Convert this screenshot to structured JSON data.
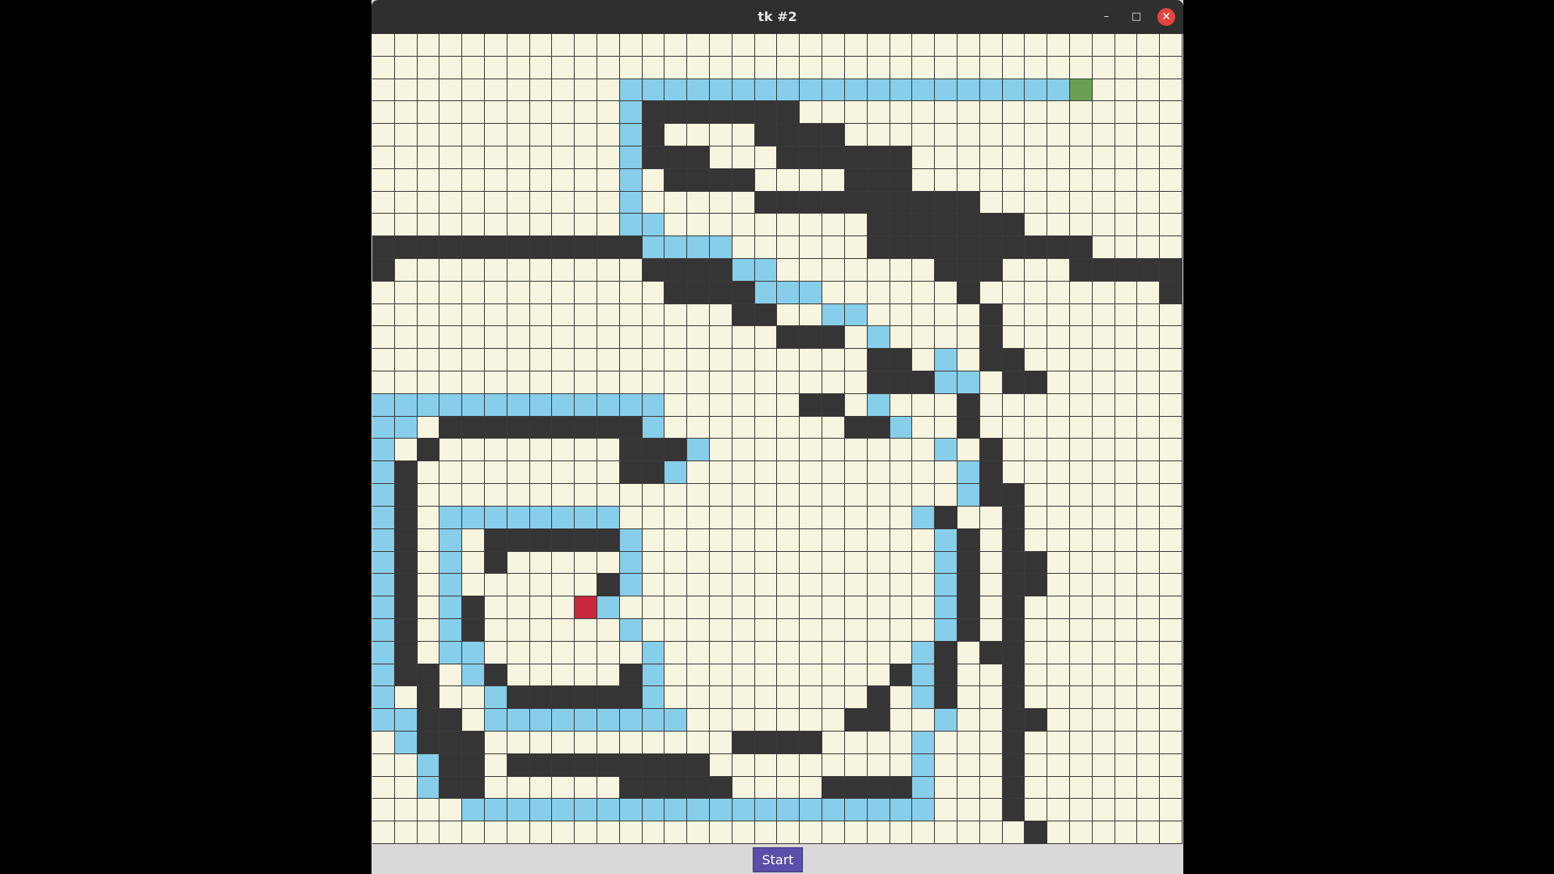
{
  "window": {
    "title": "tk #2",
    "minimize_glyph": "–",
    "maximize_glyph": "□",
    "close_glyph": "✕"
  },
  "controls": {
    "start_label": "Start"
  },
  "maze": {
    "cols": 36,
    "rows": 36,
    "legend": {
      ".": "empty",
      "#": "wall",
      "o": "path",
      "S": "start",
      "E": "end"
    },
    "colors": {
      "empty": "#f7f5df",
      "wall": "#353535",
      "path": "#87ceeb",
      "start": "#6aa054",
      "end": "#c9283c",
      "grid_line": "#3a3a3a"
    },
    "grid": [
      "....................................",
      "....................................",
      "...........ooooooooooooooooooooS....",
      "...........o#######.................",
      "...........o#....####...............",
      "...........o###...######............",
      "...........o.####....###............",
      "...........o.....##########.........",
      "...........oo.........#######.......",
      "############oooo......##########....",
      "#...........####oo.......###...#####",
      ".............####ooo......#........#",
      "................##..oo.....#.......",
      "..................###.o....#.......",
      "......................##.o.##......",
      "......................###oo.##......",
      "ooooooooooooo......##.o...#........",
      "oo.#########o........##o..#........",
      "o.#........###o..........o.#.......",
      "o#.........##o............o#.......",
      "o#........................o##......",
      "o#.oooooooo.............o#..#......",
      "o#.o.######o.............o#.#......",
      "o#.o.#.....o.............o#.##.....",
      "o#.o......#o.............o#.##.....",
      "o#.o#....Eo..............o#.#......",
      "o#.o#......o.............o#.#......",
      "o#.oo.......o...........o#.##......",
      "o##.o#.....#o..........#o#..#......",
      "o.#..o######o.........#.o#..#......",
      "oo##.ooooooooo.......##..o..##.....",
      ".o###...........####....o...#......",
      "..o##.#########.........o...#......",
      "..o##......#####....####o...#......",
      "....ooooooooooooooooooooo...#......",
      ".............................#......"
    ]
  }
}
